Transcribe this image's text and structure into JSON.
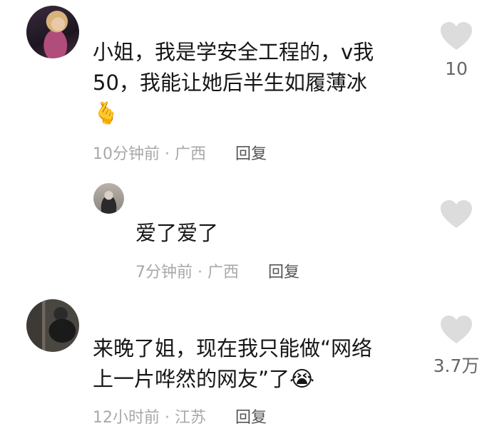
{
  "comments": [
    {
      "text_line1": "小姐，我是学安全工程的，v我",
      "text_line2": "50，我能让她后半生如履薄冰",
      "emoji": "🫰",
      "time": "10分钟前",
      "region": "广西",
      "reply_label": "回复",
      "likes": "10"
    },
    {
      "text_line1": "爱了爱了",
      "time": "7分钟前",
      "region": "广西",
      "reply_label": "回复",
      "likes": ""
    },
    {
      "text_line1": "来晚了姐，现在我只能做“网络",
      "text_line2": "上一片哗然的网友”了",
      "emoji": "😭",
      "time": "12小时前",
      "region": "江苏",
      "reply_label": "回复",
      "likes": "3.7万"
    }
  ],
  "separator": "·",
  "colors": {
    "heart": "#dcdcdc",
    "meta": "#a8a8a8",
    "text": "#161616"
  },
  "icons": [
    "heart-icon"
  ]
}
